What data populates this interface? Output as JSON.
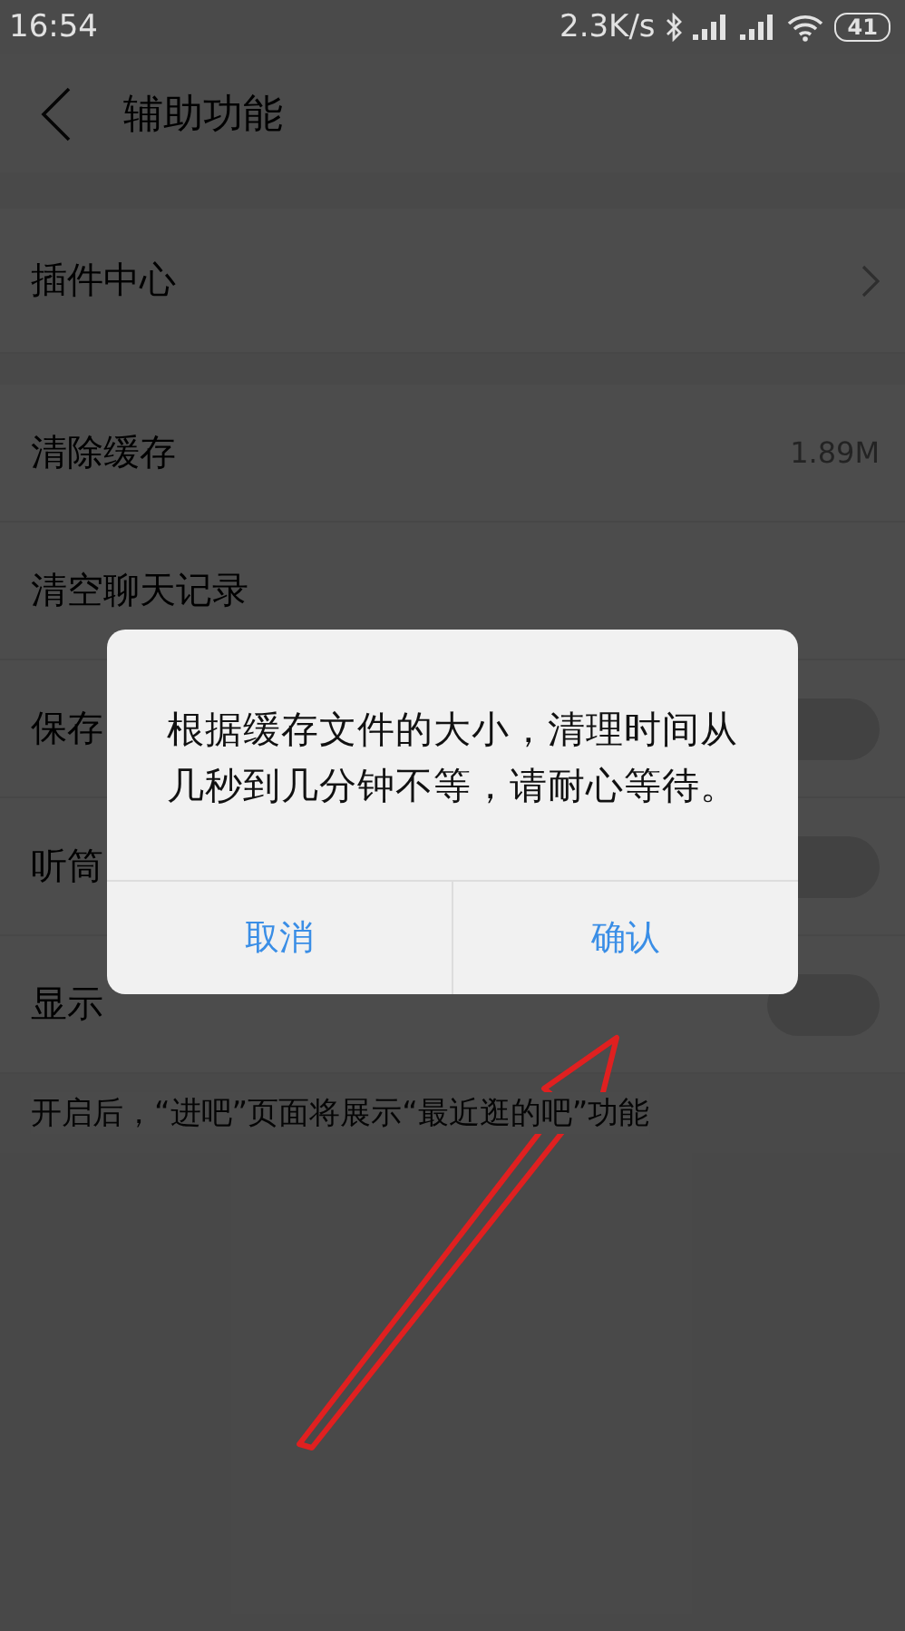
{
  "status_bar": {
    "time": "16:54",
    "network_speed": "2.3K/s",
    "battery": "41"
  },
  "header": {
    "title": "辅助功能"
  },
  "sections": [
    [
      {
        "kind": "link",
        "label": "插件中心"
      }
    ],
    [
      {
        "kind": "value",
        "label": "清除缓存",
        "value": "1.89M"
      },
      {
        "kind": "action",
        "label": "清空聊天记录"
      },
      {
        "kind": "toggle",
        "label": "保存",
        "on": false
      },
      {
        "kind": "toggle",
        "label": "听筒",
        "on": false
      },
      {
        "kind": "toggle",
        "label": "显示",
        "on": false
      }
    ]
  ],
  "footer_note": "开启后，“进吧”页面将展示“最近逛的吧”功能",
  "dialog": {
    "message": "根据缓存文件的大小，清理时间从几秒到几分钟不等，请耐心等待。",
    "buttons": [
      {
        "label": "取消"
      },
      {
        "label": "确认"
      }
    ]
  }
}
